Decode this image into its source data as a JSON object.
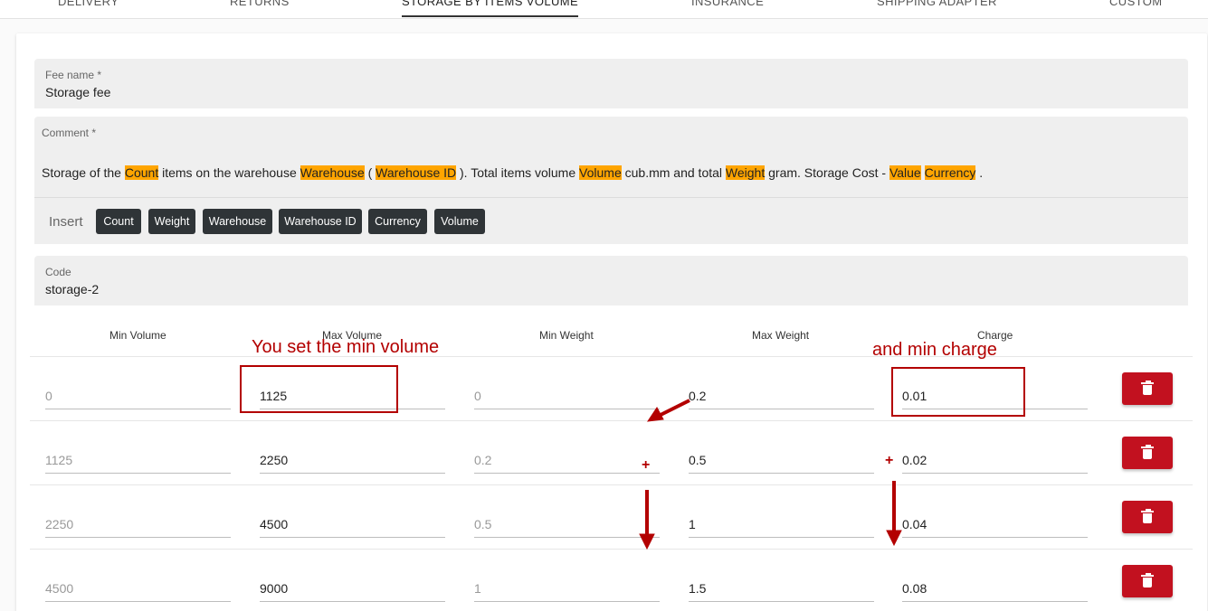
{
  "tabs": [
    {
      "label": "DELIVERY"
    },
    {
      "label": "RETURNS"
    },
    {
      "label": "STORAGE BY ITEMS VOLUME"
    },
    {
      "label": "INSURANCE"
    },
    {
      "label": "SHIPPING ADAPTER"
    },
    {
      "label": "CUSTOM"
    }
  ],
  "fee_name": {
    "label": "Fee name *",
    "value": "Storage fee"
  },
  "comment": {
    "label": "Comment *",
    "parts": [
      "Storage of the ",
      "Count",
      " items on the warehouse ",
      "Warehouse",
      " ( ",
      "Warehouse ID",
      " ). Total items volume ",
      "Volume",
      " cub.mm and total ",
      "Weight",
      " gram. Storage Cost - ",
      "Value",
      " ",
      "Currency",
      " ."
    ],
    "insert_label": "Insert",
    "chips": [
      "Count",
      "Weight",
      "Warehouse",
      "Warehouse ID",
      "Currency",
      "Volume"
    ]
  },
  "code": {
    "label": "Code",
    "value": "storage-2"
  },
  "table": {
    "headers": [
      "Min Volume",
      "Max Volume",
      "Min Weight",
      "Max Weight",
      "Charge"
    ],
    "rows": [
      [
        "0",
        "1125",
        "0",
        "0.2",
        "0.01"
      ],
      [
        "1125",
        "2250",
        "0.2",
        "0.5",
        "0.02"
      ],
      [
        "2250",
        "4500",
        "0.5",
        "1",
        "0.04"
      ],
      [
        "4500",
        "9000",
        "1",
        "1.5",
        "0.08"
      ]
    ]
  },
  "annotations": {
    "min_volume_note": "You set the min volume",
    "min_charge_note": "and min charge",
    "plus_sign": "+"
  },
  "icons": {
    "delete": "trash-icon"
  },
  "colors": {
    "highlight": "#ffa500",
    "delete_button": "#c2111f",
    "annotation": "#b30000",
    "chip": "#2f3437"
  }
}
